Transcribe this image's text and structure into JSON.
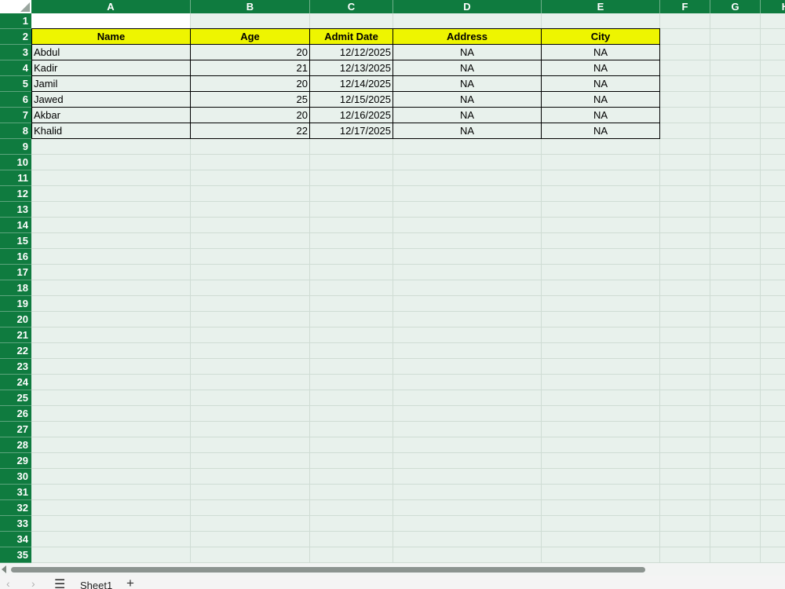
{
  "columns": [
    "A",
    "B",
    "C",
    "D",
    "E",
    "F",
    "G",
    "H"
  ],
  "row_numbers": [
    "1",
    "2",
    "3",
    "4",
    "5",
    "6",
    "7",
    "8",
    "9",
    "10",
    "11",
    "12",
    "13",
    "14",
    "15",
    "16",
    "17",
    "18",
    "19",
    "20",
    "21",
    "22",
    "23",
    "24",
    "25",
    "26",
    "27",
    "28",
    "29",
    "30",
    "31",
    "32",
    "33",
    "34",
    "35"
  ],
  "table": {
    "headers": [
      "Name",
      "Age",
      "Admit Date",
      "Address",
      "City"
    ],
    "rows": [
      [
        "Abdul",
        "20",
        "12/12/2025",
        "NA",
        "NA"
      ],
      [
        "Kadir",
        "21",
        "12/13/2025",
        "NA",
        "NA"
      ],
      [
        "Jamil",
        "20",
        "12/14/2025",
        "NA",
        "NA"
      ],
      [
        "Jawed",
        "25",
        "12/15/2025",
        "NA",
        "NA"
      ],
      [
        "Akbar",
        "20",
        "12/16/2025",
        "NA",
        "NA"
      ],
      [
        "Khalid",
        "22",
        "12/17/2025",
        "NA",
        "NA"
      ]
    ]
  },
  "tabs": {
    "sheet1": "Sheet1",
    "menu_glyph": "☰",
    "add_glyph": "+",
    "prev_glyph": "‹",
    "next_glyph": "›"
  },
  "icons": {
    "select_all": "select-all-triangle-icon"
  },
  "colors": {
    "header_green": "#0f7b3f",
    "table_header_yellow": "#eef500",
    "sheet_bg": "#e8f1ec"
  }
}
